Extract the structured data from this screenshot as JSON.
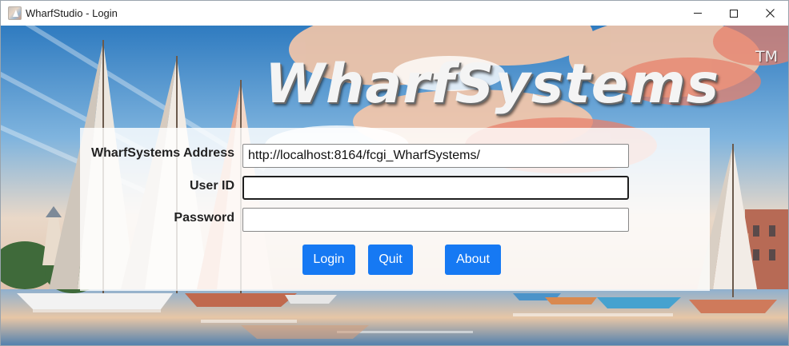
{
  "window": {
    "title": "WharfStudio - Login",
    "icon": "wharfstudio-app-icon",
    "controls": {
      "minimize_icon": "minimize-icon",
      "maximize_icon": "maximize-icon",
      "close_icon": "close-icon"
    }
  },
  "brand": {
    "logo_text": "WharfSystems",
    "trademark": "TM"
  },
  "form": {
    "address_label": "WharfSystems Address",
    "address_value": "http://localhost:8164/fcgi_WharfSystems/",
    "user_label": "User ID",
    "user_value": "",
    "password_label": "Password",
    "password_value": ""
  },
  "buttons": {
    "login": "Login",
    "quit": "Quit",
    "about": "About"
  },
  "colors": {
    "accent": "#1679f3",
    "panel": "#ffffff",
    "title_bar": "#ffffff"
  }
}
